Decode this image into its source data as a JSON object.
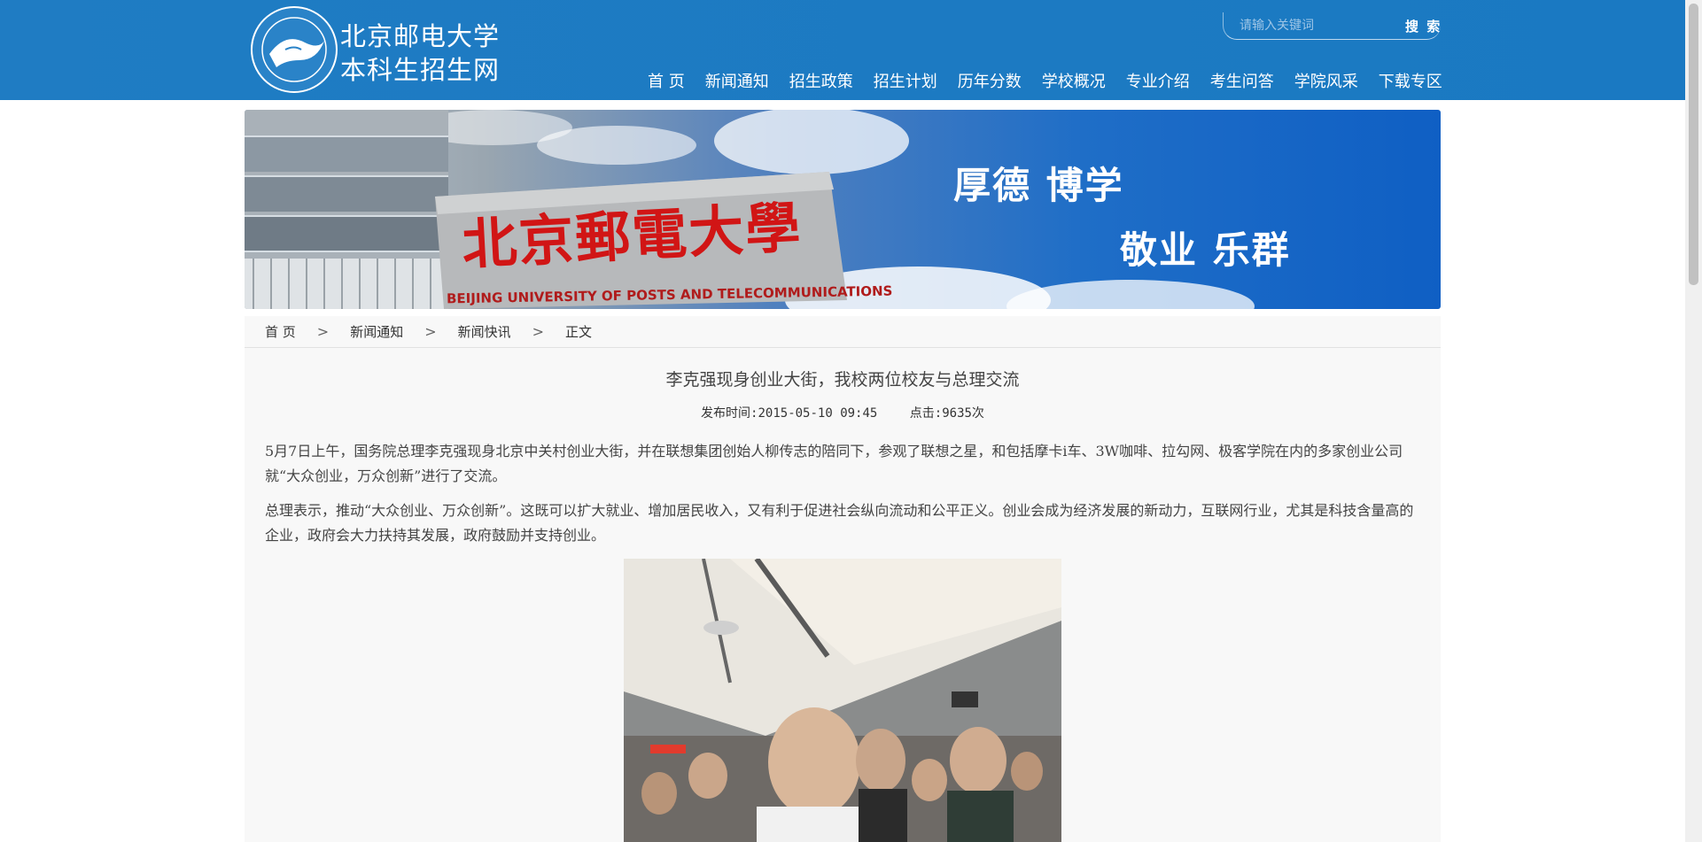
{
  "header": {
    "logo_line1": "北京邮电大学",
    "logo_line2": "本科生招生网",
    "search_placeholder": "请输入关键词",
    "search_button": "搜 索",
    "nav": [
      {
        "label": "首 页",
        "active": false
      },
      {
        "label": "新闻通知",
        "active": true
      },
      {
        "label": "招生政策",
        "active": false
      },
      {
        "label": "招生计划",
        "active": false
      },
      {
        "label": "历年分数",
        "active": false
      },
      {
        "label": "学校概况",
        "active": false
      },
      {
        "label": "专业介绍",
        "active": false
      },
      {
        "label": "考生问答",
        "active": false
      },
      {
        "label": "学院风采",
        "active": false
      },
      {
        "label": "下载专区",
        "active": false
      }
    ],
    "brand_color": "#1a79c2"
  },
  "banner": {
    "motto_line1": "厚德  博学",
    "motto_line2": "敬业  乐群",
    "sign_text": "北京郵電大學",
    "sign_en": "BEIJING UNIVERSITY OF POSTS AND TELECOMMUNICATIONS"
  },
  "breadcrumb": {
    "items": [
      "首 页",
      "新闻通知",
      "新闻快讯",
      "正文"
    ],
    "separator": ">"
  },
  "article": {
    "title": "李克强现身创业大街，我校两位校友与总理交流",
    "publish_time": "发布时间:2015-05-10 09:45",
    "clicks": "点击:9635次",
    "paragraphs": [
      "5月7日上午，国务院总理李克强现身北京中关村创业大街，并在联想集团创始人柳传志的陪同下，参观了联想之星，和包括摩卡i车、3W咖啡、拉勾网、极客学院在内的多家创业公司就“大众创业，万众创新”进行了交流。",
      "总理表示，推动“大众创业、万众创新”。这既可以扩大就业、增加居民收入，又有利于促进社会纵向流动和公平正义。创业会成为经济发展的新动力，互联网行业，尤其是科技含量高的企业，政府会大力扶持其发展，政府鼓励并支持创业。"
    ]
  }
}
